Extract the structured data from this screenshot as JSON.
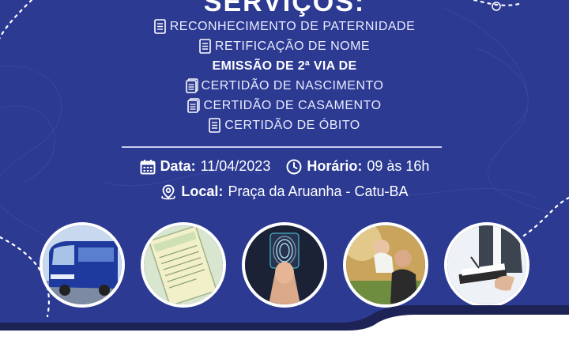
{
  "heading_partial": "SERVIÇOS:",
  "services": [
    "RECONHECIMENTO DE PATERNIDADE",
    "RETIFICAÇÃO DE NOME"
  ],
  "second_copy_heading": "EMISSÃO DE 2ª VIA DE",
  "certificates": [
    "CERTIDÃO DE NASCIMENTO",
    "CERTIDÃO DE CASAMENTO",
    "CERTIDÃO DE ÓBITO"
  ],
  "event": {
    "date_label": "Data:",
    "date_value": "11/04/2023",
    "time_label": "Horário:",
    "time_value": "09 às 16h",
    "location_label": "Local:",
    "location_value": "Praça da Aruanha - Catu-BA"
  },
  "photos": [
    {
      "name": "bus-photo"
    },
    {
      "name": "certificate-document-photo"
    },
    {
      "name": "fingerprint-photo"
    },
    {
      "name": "father-child-photo"
    },
    {
      "name": "signing-document-photo"
    }
  ],
  "colors": {
    "background": "#2c3a92",
    "text": "#ffffff",
    "photo_border": "#ffffff"
  },
  "icons": [
    "document-icon",
    "calendar-icon",
    "clock-icon",
    "location-pin-icon"
  ]
}
